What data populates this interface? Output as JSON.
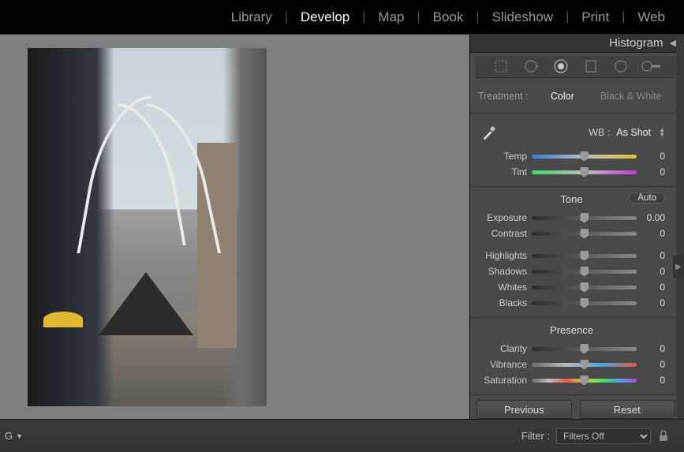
{
  "topnav": {
    "items": [
      "Library",
      "Develop",
      "Map",
      "Book",
      "Slideshow",
      "Print",
      "Web"
    ],
    "active": "Develop"
  },
  "panel": {
    "histogram_label": "Histogram",
    "treatment": {
      "label": "Treatment :",
      "color": "Color",
      "bw": "Black & White"
    },
    "wb": {
      "label": "WB :",
      "value": "As Shot",
      "temp_label": "Temp",
      "temp_val": "0",
      "tint_label": "Tint",
      "tint_val": "0"
    },
    "tone": {
      "head": "Tone",
      "auto": "Auto",
      "exposure_label": "Exposure",
      "exposure_val": "0.00",
      "contrast_label": "Contrast",
      "contrast_val": "0",
      "highlights_label": "Highlights",
      "highlights_val": "0",
      "shadows_label": "Shadows",
      "shadows_val": "0",
      "whites_label": "Whites",
      "whites_val": "0",
      "blacks_label": "Blacks",
      "blacks_val": "0"
    },
    "presence": {
      "head": "Presence",
      "clarity_label": "Clarity",
      "clarity_val": "0",
      "vibrance_label": "Vibrance",
      "vibrance_val": "0",
      "saturation_label": "Saturation",
      "saturation_val": "0"
    },
    "previous": "Previous",
    "reset": "Reset"
  },
  "bottom": {
    "sort": "G",
    "filter_label": "Filter :",
    "filter_value": "Filters Off"
  }
}
